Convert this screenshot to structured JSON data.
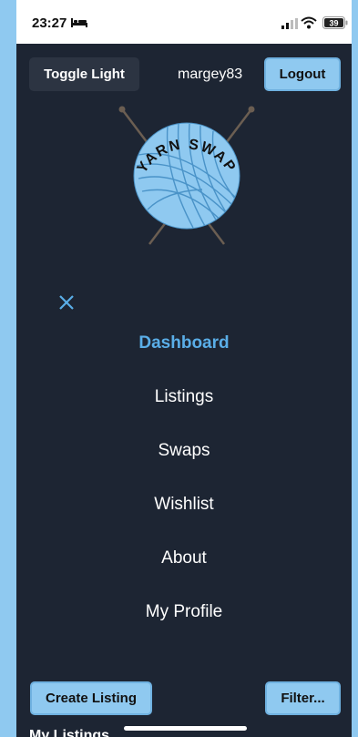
{
  "status_bar": {
    "time": "23:27",
    "battery": "39"
  },
  "header": {
    "toggle_label": "Toggle Light",
    "username": "margey83",
    "logout_label": "Logout"
  },
  "logo": {
    "text": "YARN SWAP"
  },
  "nav": {
    "items": [
      {
        "label": "Dashboard",
        "active": true
      },
      {
        "label": "Listings"
      },
      {
        "label": "Swaps"
      },
      {
        "label": "Wishlist"
      },
      {
        "label": "About"
      },
      {
        "label": "My Profile"
      }
    ]
  },
  "footer": {
    "create_label": "Create Listing",
    "filter_label": "Filter...",
    "section_title": "My Listings"
  },
  "colors": {
    "background": "#1d2533",
    "accent": "#5aaee8",
    "button_light": "#8fc9f0",
    "button_dark": "#2c3442"
  }
}
